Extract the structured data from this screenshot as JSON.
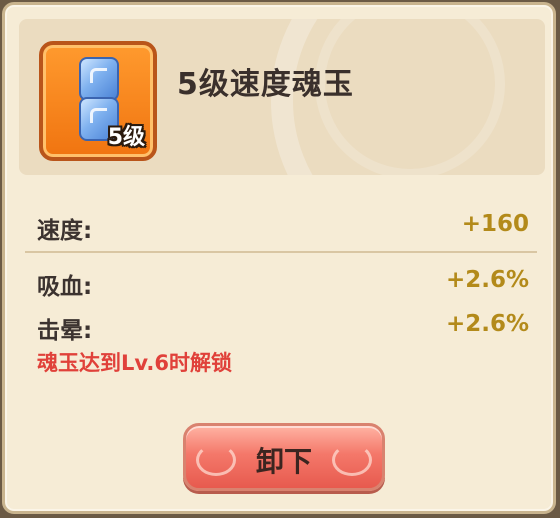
{
  "item": {
    "title": "5级速度魂玉",
    "level_badge": "5级",
    "icon": "blue-soul-jade-icon",
    "frame_color": "#f07410"
  },
  "stats": [
    {
      "label": "速度:",
      "value": "+160"
    },
    {
      "label": "吸血:",
      "value": "+2.6%"
    },
    {
      "label": "击晕:",
      "value": "+2.6%"
    }
  ],
  "unlock_hint": "魂玉达到Lv.6时解锁",
  "button": {
    "label": "卸下",
    "color": "#e75a4e"
  },
  "colors": {
    "value": "#b38a1a",
    "hint": "#e0413a",
    "panel": "#f6ecd6"
  }
}
